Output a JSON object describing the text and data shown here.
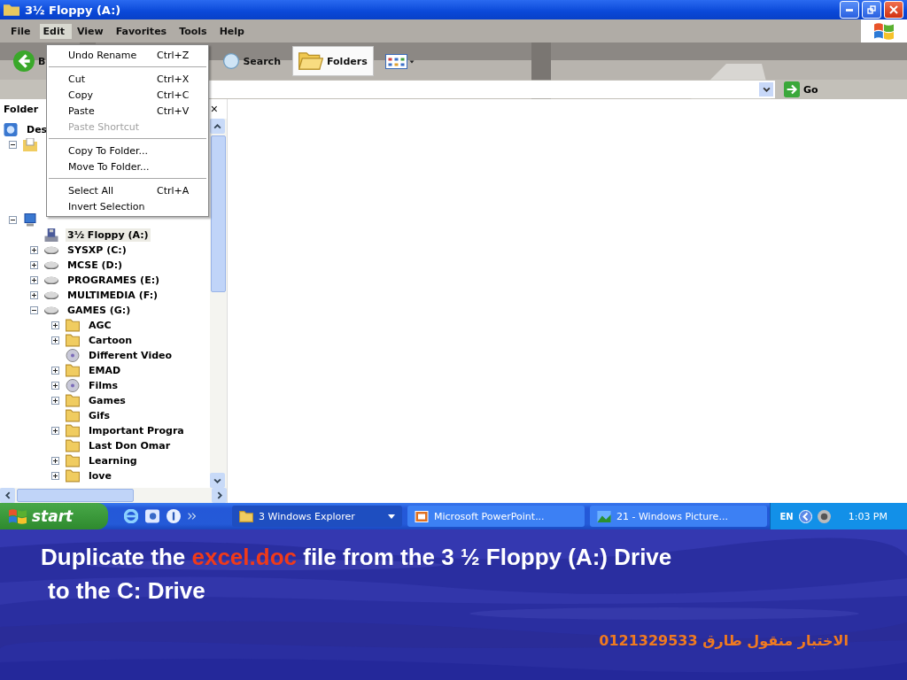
{
  "window": {
    "title": "3½ Floppy (A:)"
  },
  "menu_bar": [
    {
      "label": "File",
      "selected": false
    },
    {
      "label": "Edit",
      "selected": true
    },
    {
      "label": "View",
      "selected": false
    },
    {
      "label": "Favorites",
      "selected": false
    },
    {
      "label": "Tools",
      "selected": false
    },
    {
      "label": "Help",
      "selected": false
    }
  ],
  "toolbar": {
    "back_label": "B",
    "search_label": "Search",
    "folders": {
      "label": "Folders",
      "selected": true
    }
  },
  "address_bar": {
    "go_label": "Go"
  },
  "edit_menu": [
    {
      "kind": "item",
      "label": "Undo Rename",
      "shortcut": "Ctrl+Z",
      "disabled": false
    },
    {
      "kind": "separator"
    },
    {
      "kind": "item",
      "label": "Cut",
      "shortcut": "Ctrl+X",
      "disabled": false
    },
    {
      "kind": "item",
      "label": "Copy",
      "shortcut": "Ctrl+C",
      "disabled": false
    },
    {
      "kind": "item",
      "label": "Paste",
      "shortcut": "Ctrl+V",
      "disabled": false
    },
    {
      "kind": "item",
      "label": "Paste Shortcut",
      "disabled": true
    },
    {
      "kind": "separator"
    },
    {
      "kind": "item",
      "label": "Copy To Folder...",
      "disabled": false
    },
    {
      "kind": "item",
      "label": "Move To Folder...",
      "disabled": false
    },
    {
      "kind": "separator"
    },
    {
      "kind": "item",
      "label": "Select All",
      "shortcut": "Ctrl+A",
      "disabled": false
    },
    {
      "kind": "item",
      "label": "Invert Selection",
      "disabled": false
    }
  ],
  "folders_pane": {
    "title": "Folder",
    "close_glyph": "×",
    "tree": [
      {
        "label": "Des",
        "kind": "desktop",
        "selected": false,
        "children": [
          {
            "kind": "documents",
            "expanded": true
          },
          {
            "kind": "computer",
            "expanded": true,
            "children": [
              {
                "label": "3½ Floppy (A:)",
                "kind": "floppy",
                "selected": true
              },
              {
                "label": "SYSXP (C:)",
                "kind": "drive",
                "expanded": false,
                "selected": false
              },
              {
                "label": "MCSE (D:)",
                "kind": "drive",
                "expanded": false,
                "selected": false
              },
              {
                "label": "PROGRAMES (E:)",
                "kind": "drive",
                "expanded": false,
                "selected": false
              },
              {
                "label": "MULTIMEDIA (F:)",
                "kind": "drive",
                "expanded": false,
                "selected": false
              },
              {
                "label": "GAMES (G:)",
                "kind": "drive",
                "expanded": true,
                "selected": false,
                "children": [
                  {
                    "label": "AGC",
                    "kind": "folder",
                    "expanded": false,
                    "selected": false
                  },
                  {
                    "label": "Cartoon",
                    "kind": "folder",
                    "expanded": false,
                    "selected": false
                  },
                  {
                    "label": "Different Video",
                    "kind": "disc",
                    "selected": false
                  },
                  {
                    "label": "EMAD",
                    "kind": "folder",
                    "expanded": false,
                    "selected": false
                  },
                  {
                    "label": "Films",
                    "kind": "disc",
                    "expanded": false,
                    "selected": false
                  },
                  {
                    "label": "Games",
                    "kind": "folder",
                    "expanded": false,
                    "selected": false
                  },
                  {
                    "label": "Gifs",
                    "kind": "folder",
                    "selected": false
                  },
                  {
                    "label": "Important Progra",
                    "kind": "folder",
                    "expanded": false,
                    "selected": false
                  },
                  {
                    "label": "Last Don Omar",
                    "kind": "folder",
                    "selected": false
                  },
                  {
                    "label": "Learning",
                    "kind": "folder",
                    "expanded": false,
                    "selected": false
                  },
                  {
                    "label": "love",
                    "kind": "folder",
                    "expanded": false,
                    "selected": false
                  }
                ]
              }
            ]
          }
        ]
      }
    ]
  },
  "taskbar": {
    "start_label": "start",
    "buttons": [
      {
        "label": "3 Windows Explorer",
        "kind": "folder",
        "selected": true
      },
      {
        "label": "Microsoft PowerPoint...",
        "kind": "powerpoint",
        "selected": false
      },
      {
        "label": "21 - Windows Picture...",
        "kind": "picture",
        "selected": false
      }
    ],
    "language": "EN",
    "clock": "1:03 PM"
  },
  "slide": {
    "caption": [
      [
        {
          "text": "Duplicate the ",
          "highlight": false
        },
        {
          "text": "excel.doc",
          "highlight": true
        },
        {
          "text": " file from the 3 ½ Floppy (A:) Drive",
          "highlight": false
        }
      ],
      [
        {
          "text": "to the C: Drive",
          "highlight": false
        }
      ]
    ],
    "footer": "الاختبار منقول طارق 0121329533"
  }
}
